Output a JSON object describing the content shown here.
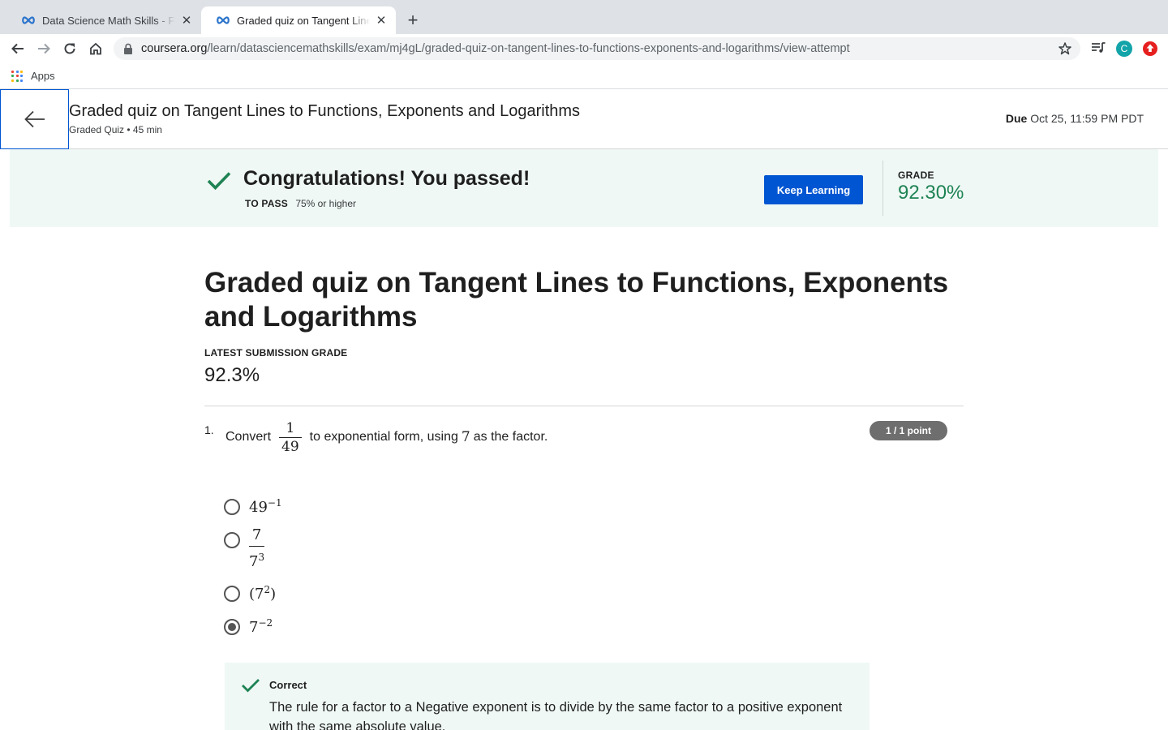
{
  "browser": {
    "tabs": [
      {
        "title": "Data Science Math Skills - Fun",
        "active": false
      },
      {
        "title": "Graded quiz on Tangent Lines to Functions",
        "active": true
      }
    ],
    "url_host": "coursera.org",
    "url_path": "/learn/datasciencemathskills/exam/mj4gL/graded-quiz-on-tangent-lines-to-functions-exponents-and-logarithms/view-attempt",
    "profile_initial": "C",
    "bookmarks_apps_label": "Apps"
  },
  "header": {
    "title": "Graded quiz on Tangent Lines to Functions, Exponents and Logarithms",
    "subtitle": "Graded Quiz • 45 min",
    "due_label": "Due",
    "due_value": "Oct 25, 11:59 PM PDT"
  },
  "banner": {
    "message": "Congratulations! You passed!",
    "to_pass_label": "TO PASS",
    "to_pass_value": "75% or higher",
    "keep_learning_label": "Keep Learning",
    "grade_label": "GRADE",
    "grade_value": "92.30%"
  },
  "main": {
    "title": "Graded quiz on Tangent Lines to Functions, Exponents and Logarithms",
    "latest_grade_label": "LATEST SUBMISSION GRADE",
    "latest_grade_value": "92.3%"
  },
  "question": {
    "number": "1.",
    "text_before": "Convert",
    "fraction_num": "1",
    "fraction_den": "49",
    "text_middle": "to exponential form, using",
    "factor": "7",
    "text_after": "as the factor.",
    "points": "1 / 1 point",
    "options": [
      {
        "base": "49",
        "exp": "−1",
        "selected": false
      },
      {
        "num": "7",
        "den_base": "7",
        "den_exp": "3",
        "selected": false
      },
      {
        "open": "(",
        "base": "7",
        "exp": "2",
        "close": ")",
        "selected": false
      },
      {
        "base": "7",
        "exp": "−2",
        "selected": true
      }
    ],
    "feedback": {
      "status": "Correct",
      "text": "The rule for a factor to a Negative exponent is to divide by the same factor to a positive exponent with the same absolute value."
    }
  },
  "colors": {
    "primary_blue": "#0056d2",
    "success_green": "#1f8354",
    "banner_bg": "#eff8f5"
  },
  "icons": [
    "coursera-infinity-icon",
    "close-icon",
    "plus-icon",
    "back-arrow-icon",
    "forward-arrow-icon",
    "reload-icon",
    "home-icon",
    "lock-icon",
    "star-icon",
    "media-control-icon",
    "extension-icon",
    "apps-grid-icon",
    "arrow-left-icon",
    "checkmark-icon"
  ]
}
